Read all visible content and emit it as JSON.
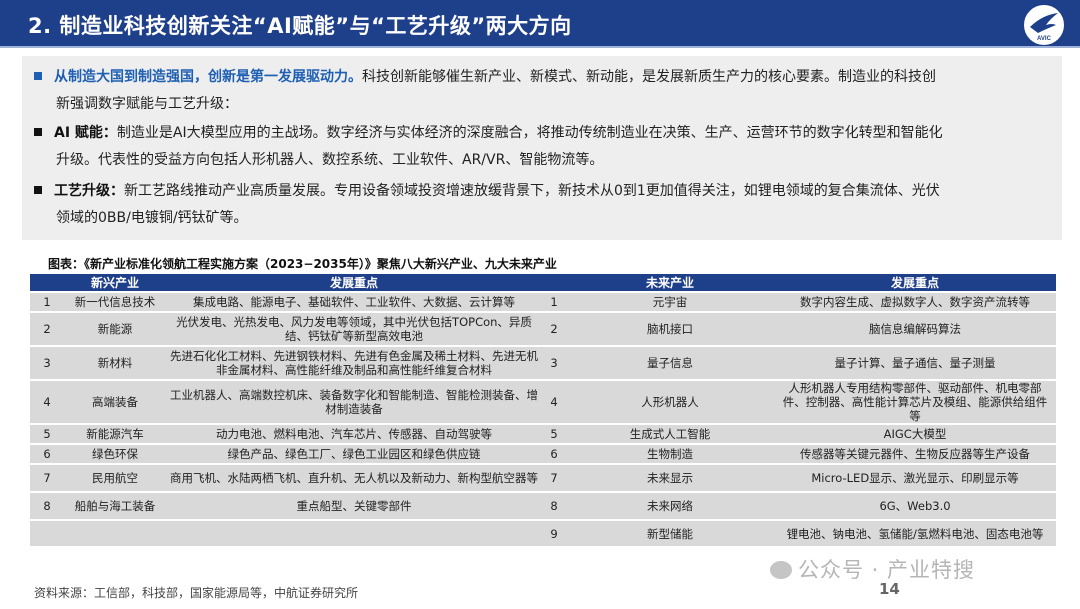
{
  "title": "2. 制造业科技创新关注“AI赋能”与“工艺升级”两大方向",
  "logo_text": "AVIC",
  "intro": {
    "p1_lead": "从制造大国到制造强国，创新是第一发展驱动力。",
    "p1_body": "科技创新能够催生新产业、新模式、新动能，是发展新质生产力的核心要素。制造业的科技创",
    "p1_cont": "新强调数字赋能与工艺升级：",
    "p2_lead": "AI 赋能：",
    "p2_body": "制造业是AI大模型应用的主战场。数字经济与实体经济的深度融合，将推动传统制造业在决策、生产、运营环节的数字化转型和智能化",
    "p2_cont": "升级。代表性的受益方向包括人形机器人、数控系统、工业软件、AR/VR、智能物流等。",
    "p3_lead": "工艺升级：",
    "p3_body": "新工艺路线推动产业高质量发展。专用设备领域投资增速放缓背景下，新技术从0到1更加值得关注，如锂电领域的复合集流体、光伏",
    "p3_cont": "领域的0BB/电镀铜/钙钛矿等。"
  },
  "table_caption": "图表：《新产业标准化领航工程实施方案（2023−2035年）》聚焦八大新兴产业、九大未来产业",
  "table": {
    "headers": [
      "",
      "新兴产业",
      "发展重点",
      "",
      "未来产业",
      "发展重点"
    ],
    "rows": [
      [
        "1",
        "新一代信息技术",
        "集成电路、能源电子、基础软件、工业软件、大数据、云计算等",
        "1",
        "元宇宙",
        "数字内容生成、虚拟数字人、数字资产流转等"
      ],
      [
        "2",
        "新能源",
        "光伏发电、光热发电、风力发电等领域，其中光伏包括TOPCon、异质结、钙钛矿等新型高效电池",
        "2",
        "脑机接口",
        "脑信息编解码算法"
      ],
      [
        "3",
        "新材料",
        "先进石化化工材料、先进钢铁材料、先进有色金属及稀土材料、先进无机非金属材料、高性能纤维及制品和高性能纤维复合材料",
        "3",
        "量子信息",
        "量子计算、量子通信、量子测量"
      ],
      [
        "4",
        "高端装备",
        "工业机器人、高端数控机床、装备数字化和智能制造、智能检测装备、增材制造装备",
        "4",
        "人形机器人",
        "人形机器人专用结构零部件、驱动部件、机电零部件、控制器、高性能计算芯片及模组、能源供给组件等"
      ],
      [
        "5",
        "新能源汽车",
        "动力电池、燃料电池、汽车芯片、传感器、自动驾驶等",
        "5",
        "生成式人工智能",
        "AIGC大模型"
      ],
      [
        "6",
        "绿色环保",
        "绿色产品、绿色工厂、绿色工业园区和绿色供应链",
        "6",
        "生物制造",
        "传感器等关键元器件、生物反应器等生产设备"
      ],
      [
        "7",
        "民用航空",
        "商用飞机、水陆两栖飞机、直升机、无人机以及新动力、新构型航空器等",
        "7",
        "未来显示",
        "Micro-LED显示、激光显示、印刷显示等"
      ],
      [
        "8",
        "船舶与海工装备",
        "重点船型、关键零部件",
        "8",
        "未来网络",
        "6G、Web3.0"
      ],
      [
        "",
        "",
        "",
        "9",
        "新型储能",
        "锂电池、钠电池、氢储能/氢燃料电池、固态电池等"
      ]
    ]
  },
  "footer": {
    "source": "资料来源：工信部，科技部，国家能源局等，中航证券研究所",
    "page": "14",
    "watermark": "公众号 · 产业特搜"
  }
}
